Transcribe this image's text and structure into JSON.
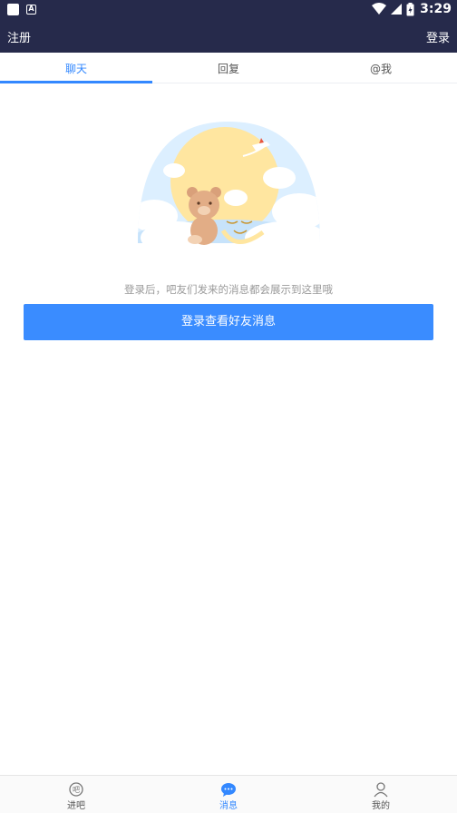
{
  "status_bar": {
    "time": "3:29"
  },
  "header": {
    "left_action": "注册",
    "right_action": "登录"
  },
  "tabs": [
    {
      "label": "聊天",
      "active": true
    },
    {
      "label": "回复",
      "active": false
    },
    {
      "label": "@我",
      "active": false
    }
  ],
  "empty_state": {
    "hint": "登录后，吧友们发来的消息都会展示到这里哦",
    "button_label": "登录查看好友消息"
  },
  "bottom_nav": [
    {
      "label": "进吧",
      "icon": "ba-icon",
      "active": false
    },
    {
      "label": "消息",
      "icon": "message-icon",
      "active": true
    },
    {
      "label": "我的",
      "icon": "person-icon",
      "active": false
    }
  ],
  "colors": {
    "header_bg": "#262a4b",
    "accent": "#3388ff",
    "button_bg": "#3a8cff"
  }
}
